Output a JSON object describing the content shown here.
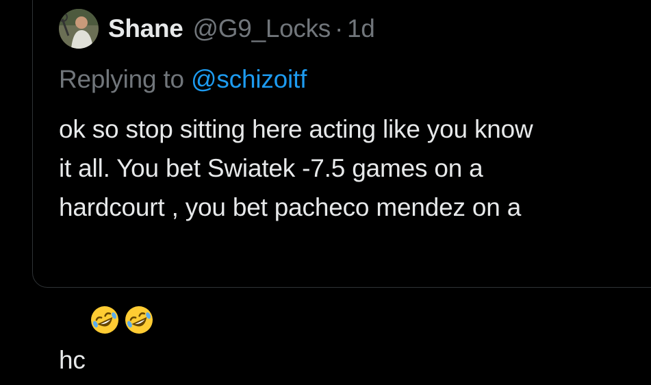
{
  "tweet": {
    "author_name": "Shane",
    "handle": "@G9_Locks",
    "separator": "·",
    "time": "1d",
    "replying_prefix": "Replying to ",
    "replying_handle": "@schizoitf",
    "line1": "ok so stop sitting here acting like you know",
    "line2": "it all. You bet Swiatek -7.5 games on a",
    "line3": "hardcourt , you bet pacheco mendez on a",
    "line4": "hc",
    "emojis": [
      "rolling-on-floor-laughing-emoji",
      "rolling-on-floor-laughing-emoji"
    ]
  },
  "colors": {
    "background": "#000000",
    "text_primary": "#e7e9ea",
    "text_secondary": "#71767b",
    "link": "#1d9bf0",
    "border": "#2f3336"
  }
}
